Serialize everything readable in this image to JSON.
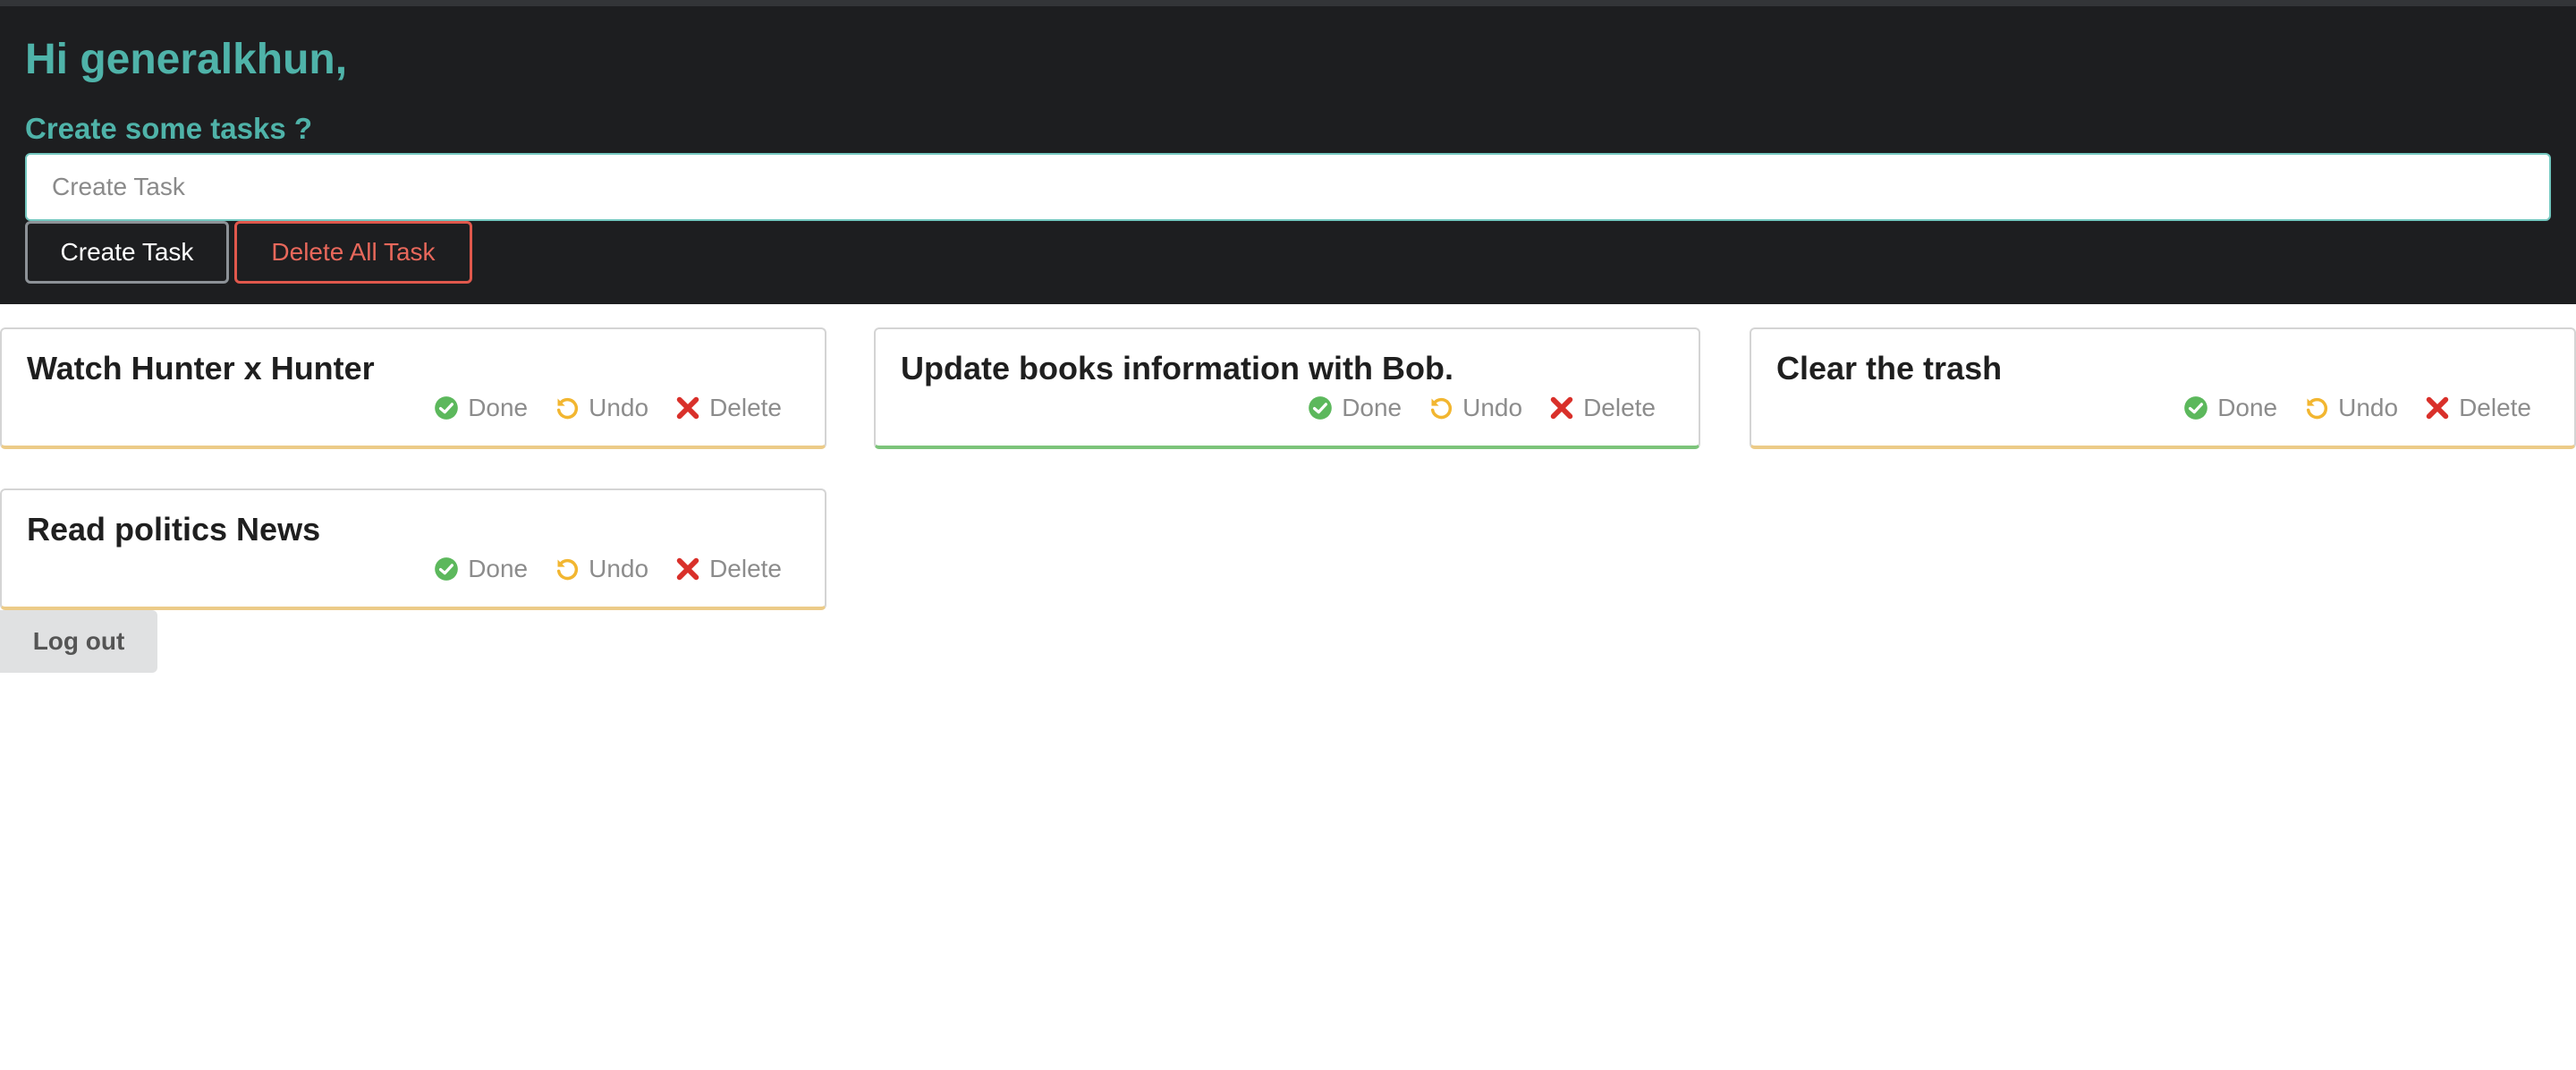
{
  "header": {
    "greeting": "Hi generalkhun,",
    "prompt": "Create some tasks ?",
    "input_placeholder": "Create Task",
    "input_value": "",
    "create_label": "Create Task",
    "delete_all_label": "Delete All Task"
  },
  "tasks": [
    {
      "title": "Watch Hunter x Hunter",
      "status": "pending"
    },
    {
      "title": "Update books information with Bob.",
      "status": "done"
    },
    {
      "title": "Clear the trash",
      "status": "pending"
    },
    {
      "title": "Read politics News",
      "status": "pending"
    }
  ],
  "actions": {
    "done_label": "Done",
    "undo_label": "Undo",
    "delete_label": "Delete"
  },
  "icons": {
    "done": "check-circle-icon",
    "undo": "undo-icon",
    "delete": "close-icon"
  },
  "colors": {
    "accent": "#4fb3a9",
    "header_bg": "#1d1e20",
    "done_green": "#5cb85c",
    "undo_yellow": "#f2b630",
    "delete_red": "#d9302a",
    "pending_border": "#eccb88",
    "done_border": "#7cc47a"
  },
  "logout_label": "Log out"
}
